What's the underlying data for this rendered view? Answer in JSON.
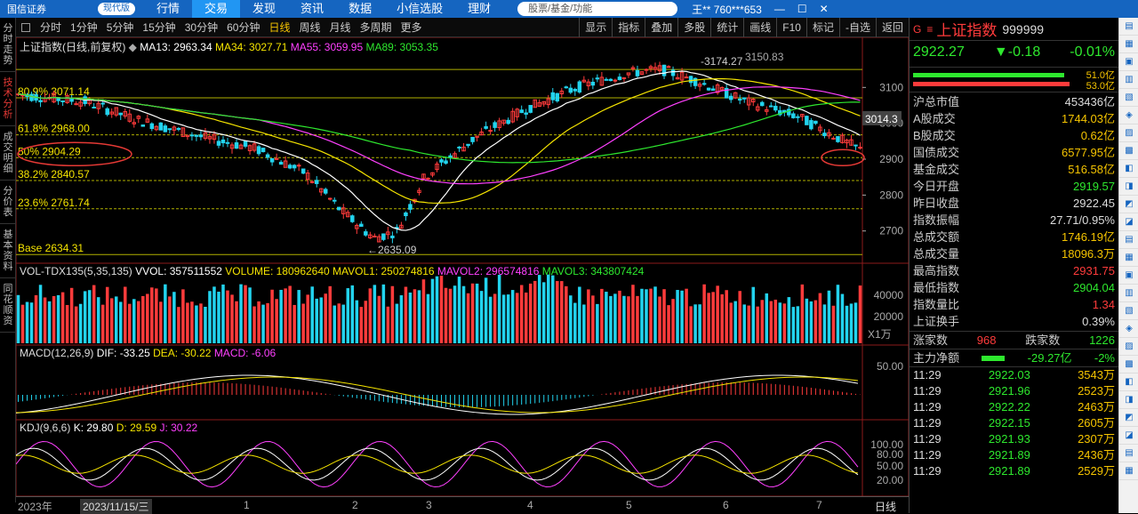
{
  "topbar": {
    "logo": "国信证券",
    "version": "现代版",
    "menus": [
      "行情",
      "交易",
      "发现",
      "资讯",
      "数据",
      "小信选股",
      "理财"
    ],
    "active": "交易",
    "search_placeholder": "股票/基金/功能",
    "user": "王** 760***653"
  },
  "leftnav": [
    "分时走势",
    "技术分析",
    "成交明细",
    "分价表",
    "基本资料",
    "同花顺资"
  ],
  "leftnav_active": "技术分析",
  "periods": [
    "分时",
    "1分钟",
    "5分钟",
    "15分钟",
    "30分钟",
    "60分钟",
    "日线",
    "周线",
    "月线",
    "多周期",
    "更多"
  ],
  "period_active": "日线",
  "toolbar": [
    "显示",
    "指标",
    "叠加",
    "多股",
    "统计",
    "画线",
    "F10",
    "标记",
    "-自选",
    "返回"
  ],
  "main": {
    "title": "上证指数(日线,前复权)",
    "ma13": "MA13: 2963.34",
    "ma34": "MA34: 3027.71",
    "ma55": "MA55: 3059.95",
    "ma89": "MA89: 3053.35",
    "fib": [
      {
        "label": "80.9% 3071.14",
        "v": 3071.14
      },
      {
        "label": "61.8% 2968.00",
        "v": 2968.0
      },
      {
        "label": "50% 2904.29",
        "v": 2904.29
      },
      {
        "label": "38.2% 2840.57",
        "v": 2840.57
      },
      {
        "label": "23.6% 2761.74",
        "v": 2761.74
      },
      {
        "label": "Base 2634.31",
        "v": 2634.31
      }
    ],
    "high_label": "3174.27",
    "high2_label": "3150.83",
    "low_label": "2635.09",
    "price_tag": "3014.3",
    "yticks": [
      "3100",
      "3000",
      "2900",
      "2800",
      "2700"
    ],
    "ylim": [
      2620,
      3190
    ]
  },
  "vol": {
    "title": "VOL-TDX135(5,35,135)",
    "vvol": "VVOL: 357511552",
    "volume": "VOLUME: 180962640",
    "mavol1": "MAVOL1: 250274816",
    "mavol2": "MAVOL2: 296574816",
    "mavol3": "MAVOL3: 343807424",
    "yticks": [
      "40000",
      "20000"
    ],
    "unit": "X1万"
  },
  "macd": {
    "title": "MACD(12,26,9)",
    "dif": "DIF: -33.25",
    "dea": "DEA: -30.22",
    "macd": "MACD: -6.06",
    "ytick": "50.00"
  },
  "kdj": {
    "title": "KDJ(9,6,6)",
    "k": "K: 29.80",
    "d": "D: 29.59",
    "j": "J: 30.22",
    "yticks": [
      "100.00",
      "80.00",
      "50.00",
      "20.00"
    ]
  },
  "xaxis": {
    "labels": [
      "2023年",
      "2023/11/15/三",
      "1",
      "2",
      "3",
      "4",
      "5",
      "6",
      "7"
    ],
    "period": "日线"
  },
  "right": {
    "code_prefix": "G",
    "name": "上证指数",
    "code": "999999",
    "price": "2922.27",
    "change": "▼-0.18",
    "pct": "-0.01%",
    "buy": "51.0亿",
    "sell": "53.0亿",
    "rows": [
      [
        "沪总市值",
        "453436亿",
        "white"
      ],
      [
        "A股成交",
        "1744.03亿",
        "yellow"
      ],
      [
        "B股成交",
        "0.62亿",
        "yellow"
      ],
      [
        "国债成交",
        "6577.95亿",
        "yellow"
      ],
      [
        "基金成交",
        "516.58亿",
        "yellow"
      ],
      [
        "今日开盘",
        "2919.57",
        "green"
      ],
      [
        "昨日收盘",
        "2922.45",
        "white"
      ],
      [
        "指数振幅",
        "27.71/0.95%",
        "white"
      ],
      [
        "总成交额",
        "1746.19亿",
        "yellow"
      ],
      [
        "总成交量",
        "18096.3万",
        "yellow"
      ],
      [
        "最高指数",
        "2931.75",
        "red"
      ],
      [
        "最低指数",
        "2904.04",
        "green"
      ],
      [
        "指数量比",
        "1.34",
        "red"
      ],
      [
        "上证换手",
        "0.39%",
        "white"
      ]
    ],
    "up_label": "涨家数",
    "up": "968",
    "down_label": "跌家数",
    "down": "1226",
    "flow_label": "主力净额",
    "flow": "-29.27亿",
    "flow_pct": "-2%",
    "ticks": [
      [
        "11:29",
        "2922.03",
        "3543万"
      ],
      [
        "11:29",
        "2921.96",
        "2523万"
      ],
      [
        "11:29",
        "2922.22",
        "2463万"
      ],
      [
        "11:29",
        "2922.15",
        "2605万"
      ],
      [
        "11:29",
        "2921.93",
        "2307万"
      ],
      [
        "11:29",
        "2921.89",
        "2436万"
      ],
      [
        "11:29",
        "2921.89",
        "2529万"
      ]
    ]
  }
}
